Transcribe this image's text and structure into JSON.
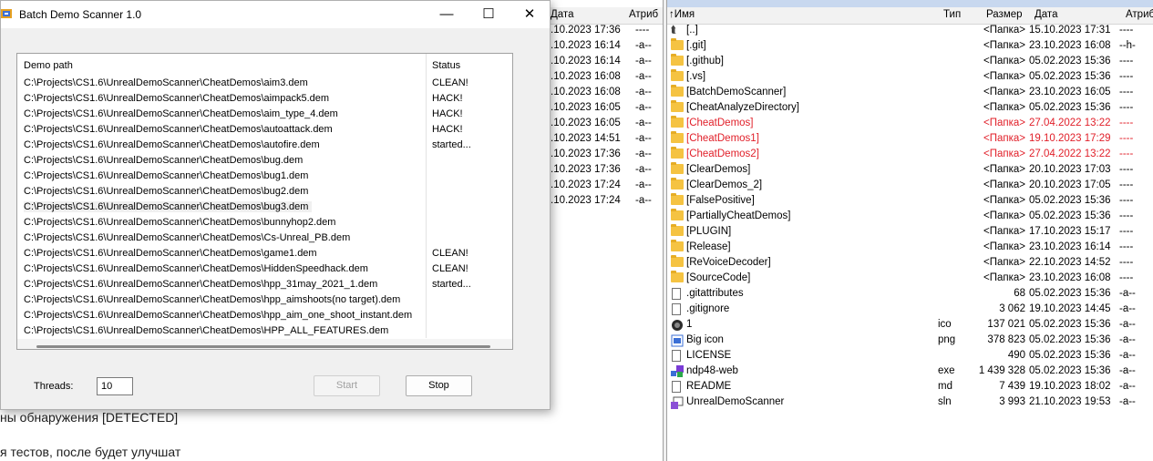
{
  "dialog": {
    "title": "Batch Demo Scanner  1.0",
    "minimize": "—",
    "maximize": "☐",
    "close": "✕",
    "columns": {
      "path": "Demo path",
      "status": "Status"
    },
    "rows": [
      {
        "path": "C:\\Projects\\CS1.6\\UnrealDemoScanner\\CheatDemos\\aim3.dem",
        "status": "CLEAN!"
      },
      {
        "path": "C:\\Projects\\CS1.6\\UnrealDemoScanner\\CheatDemos\\aimpack5.dem",
        "status": "HACK!"
      },
      {
        "path": "C:\\Projects\\CS1.6\\UnrealDemoScanner\\CheatDemos\\aim_type_4.dem",
        "status": "HACK!"
      },
      {
        "path": "C:\\Projects\\CS1.6\\UnrealDemoScanner\\CheatDemos\\autoattack.dem",
        "status": "HACK!"
      },
      {
        "path": "C:\\Projects\\CS1.6\\UnrealDemoScanner\\CheatDemos\\autofire.dem",
        "status": "started..."
      },
      {
        "path": "C:\\Projects\\CS1.6\\UnrealDemoScanner\\CheatDemos\\bug.dem",
        "status": ""
      },
      {
        "path": "C:\\Projects\\CS1.6\\UnrealDemoScanner\\CheatDemos\\bug1.dem",
        "status": ""
      },
      {
        "path": "C:\\Projects\\CS1.6\\UnrealDemoScanner\\CheatDemos\\bug2.dem",
        "status": ""
      },
      {
        "path": "C:\\Projects\\CS1.6\\UnrealDemoScanner\\CheatDemos\\bug3.dem",
        "status": ""
      },
      {
        "path": "C:\\Projects\\CS1.6\\UnrealDemoScanner\\CheatDemos\\bunnyhop2.dem",
        "status": ""
      },
      {
        "path": "C:\\Projects\\CS1.6\\UnrealDemoScanner\\CheatDemos\\Cs-Unreal_PB.dem",
        "status": ""
      },
      {
        "path": "C:\\Projects\\CS1.6\\UnrealDemoScanner\\CheatDemos\\game1.dem",
        "status": "CLEAN!"
      },
      {
        "path": "C:\\Projects\\CS1.6\\UnrealDemoScanner\\CheatDemos\\HiddenSpeedhack.dem",
        "status": "CLEAN!"
      },
      {
        "path": "C:\\Projects\\CS1.6\\UnrealDemoScanner\\CheatDemos\\hpp_31may_2021_1.dem",
        "status": "started..."
      },
      {
        "path": "C:\\Projects\\CS1.6\\UnrealDemoScanner\\CheatDemos\\hpp_aimshoots(no target).dem",
        "status": ""
      },
      {
        "path": "C:\\Projects\\CS1.6\\UnrealDemoScanner\\CheatDemos\\hpp_aim_one_shoot_instant.dem",
        "status": ""
      },
      {
        "path": "C:\\Projects\\CS1.6\\UnrealDemoScanner\\CheatDemos\\HPP_ALL_FEATURES.dem",
        "status": ""
      }
    ],
    "threads_label": "Threads:",
    "threads_value": "10",
    "start_label": "Start",
    "stop_label": "Stop"
  },
  "mid_panel": {
    "headers": {
      "date": "Дата",
      "attr": "Атриб"
    },
    "rows": [
      {
        "date": ".10.2023 17:36",
        "attr": "----"
      },
      {
        "date": ".10.2023 16:14",
        "attr": "-a--"
      },
      {
        "date": ".10.2023 16:14",
        "attr": "-a--"
      },
      {
        "date": ".10.2023 16:08",
        "attr": "-a--"
      },
      {
        "date": ".10.2023 16:08",
        "attr": "-a--"
      },
      {
        "date": ".10.2023 16:05",
        "attr": "-a--"
      },
      {
        "date": ".10.2023 16:05",
        "attr": "-a--"
      },
      {
        "date": ".10.2023 14:51",
        "attr": "-a--"
      },
      {
        "date": ".10.2023 17:36",
        "attr": "-a--"
      },
      {
        "date": ".10.2023 17:36",
        "attr": "-a--"
      },
      {
        "date": ".10.2023 17:24",
        "attr": "-a--"
      },
      {
        "date": ".10.2023 17:24",
        "attr": "-a--"
      }
    ]
  },
  "bg_text": {
    "line1": "ны обнаружения [DETECTED]",
    "line2": "я тестов, после будет улучшат"
  },
  "right_panel": {
    "headers": {
      "name": "↑Имя",
      "type": "Тип",
      "size": "Размер",
      "date": "Дата",
      "attr": "Атриб"
    },
    "rows": [
      {
        "name": "[..]",
        "type": "",
        "size": "<Папка>",
        "date": "15.10.2023 17:31",
        "attr": "----",
        "kind": "up",
        "red": false
      },
      {
        "name": "[.git]",
        "type": "",
        "size": "<Папка>",
        "date": "23.10.2023 16:08",
        "attr": "--h-",
        "kind": "folder",
        "red": false
      },
      {
        "name": "[.github]",
        "type": "",
        "size": "<Папка>",
        "date": "05.02.2023 15:36",
        "attr": "----",
        "kind": "folder",
        "red": false
      },
      {
        "name": "[.vs]",
        "type": "",
        "size": "<Папка>",
        "date": "05.02.2023 15:36",
        "attr": "----",
        "kind": "folder",
        "red": false
      },
      {
        "name": "[BatchDemoScanner]",
        "type": "",
        "size": "<Папка>",
        "date": "23.10.2023 16:05",
        "attr": "----",
        "kind": "folder",
        "red": false
      },
      {
        "name": "[CheatAnalyzeDirectory]",
        "type": "",
        "size": "<Папка>",
        "date": "05.02.2023 15:36",
        "attr": "----",
        "kind": "folder",
        "red": false
      },
      {
        "name": "[CheatDemos]",
        "type": "",
        "size": "<Папка>",
        "date": "27.04.2022 13:22",
        "attr": "----",
        "kind": "folder",
        "red": true
      },
      {
        "name": "[CheatDemos1]",
        "type": "",
        "size": "<Папка>",
        "date": "19.10.2023 17:29",
        "attr": "----",
        "kind": "folder",
        "red": true
      },
      {
        "name": "[CheatDemos2]",
        "type": "",
        "size": "<Папка>",
        "date": "27.04.2022 13:22",
        "attr": "----",
        "kind": "folder",
        "red": true
      },
      {
        "name": "[ClearDemos]",
        "type": "",
        "size": "<Папка>",
        "date": "20.10.2023 17:03",
        "attr": "----",
        "kind": "folder",
        "red": false
      },
      {
        "name": "[ClearDemos_2]",
        "type": "",
        "size": "<Папка>",
        "date": "20.10.2023 17:05",
        "attr": "----",
        "kind": "folder",
        "red": false
      },
      {
        "name": "[FalsePositive]",
        "type": "",
        "size": "<Папка>",
        "date": "05.02.2023 15:36",
        "attr": "----",
        "kind": "folder",
        "red": false
      },
      {
        "name": "[PartiallyCheatDemos]",
        "type": "",
        "size": "<Папка>",
        "date": "05.02.2023 15:36",
        "attr": "----",
        "kind": "folder",
        "red": false
      },
      {
        "name": "[PLUGIN]",
        "type": "",
        "size": "<Папка>",
        "date": "17.10.2023 15:17",
        "attr": "----",
        "kind": "folder",
        "red": false
      },
      {
        "name": "[Release]",
        "type": "",
        "size": "<Папка>",
        "date": "23.10.2023 16:14",
        "attr": "----",
        "kind": "folder",
        "red": false
      },
      {
        "name": "[ReVoiceDecoder]",
        "type": "",
        "size": "<Папка>",
        "date": "22.10.2023 14:52",
        "attr": "----",
        "kind": "folder",
        "red": false
      },
      {
        "name": "[SourceCode]",
        "type": "",
        "size": "<Папка>",
        "date": "23.10.2023 16:08",
        "attr": "----",
        "kind": "folder",
        "red": false
      },
      {
        "name": ".gitattributes",
        "type": "",
        "size": "68",
        "date": "05.02.2023 15:36",
        "attr": "-a--",
        "kind": "file",
        "red": false
      },
      {
        "name": ".gitignore",
        "type": "",
        "size": "3 062",
        "date": "19.10.2023 14:45",
        "attr": "-a--",
        "kind": "file",
        "red": false
      },
      {
        "name": "1",
        "type": "ico",
        "size": "137 021",
        "date": "05.02.2023 15:36",
        "attr": "-a--",
        "kind": "ico",
        "red": false
      },
      {
        "name": "Big icon",
        "type": "png",
        "size": "378 823",
        "date": "05.02.2023 15:36",
        "attr": "-a--",
        "kind": "png",
        "red": false
      },
      {
        "name": "LICENSE",
        "type": "",
        "size": "490",
        "date": "05.02.2023 15:36",
        "attr": "-a--",
        "kind": "file",
        "red": false
      },
      {
        "name": "ndp48-web",
        "type": "exe",
        "size": "1 439 328",
        "date": "05.02.2023 15:36",
        "attr": "-a--",
        "kind": "exe",
        "red": false
      },
      {
        "name": "README",
        "type": "md",
        "size": "7 439",
        "date": "19.10.2023 18:02",
        "attr": "-a--",
        "kind": "file",
        "red": false
      },
      {
        "name": "UnrealDemoScanner",
        "type": "sln",
        "size": "3 993",
        "date": "21.10.2023 19:53",
        "attr": "-a--",
        "kind": "sln",
        "red": false
      }
    ]
  },
  "colors": {
    "red_text": "#e1202a",
    "folder": "#f5c342"
  }
}
